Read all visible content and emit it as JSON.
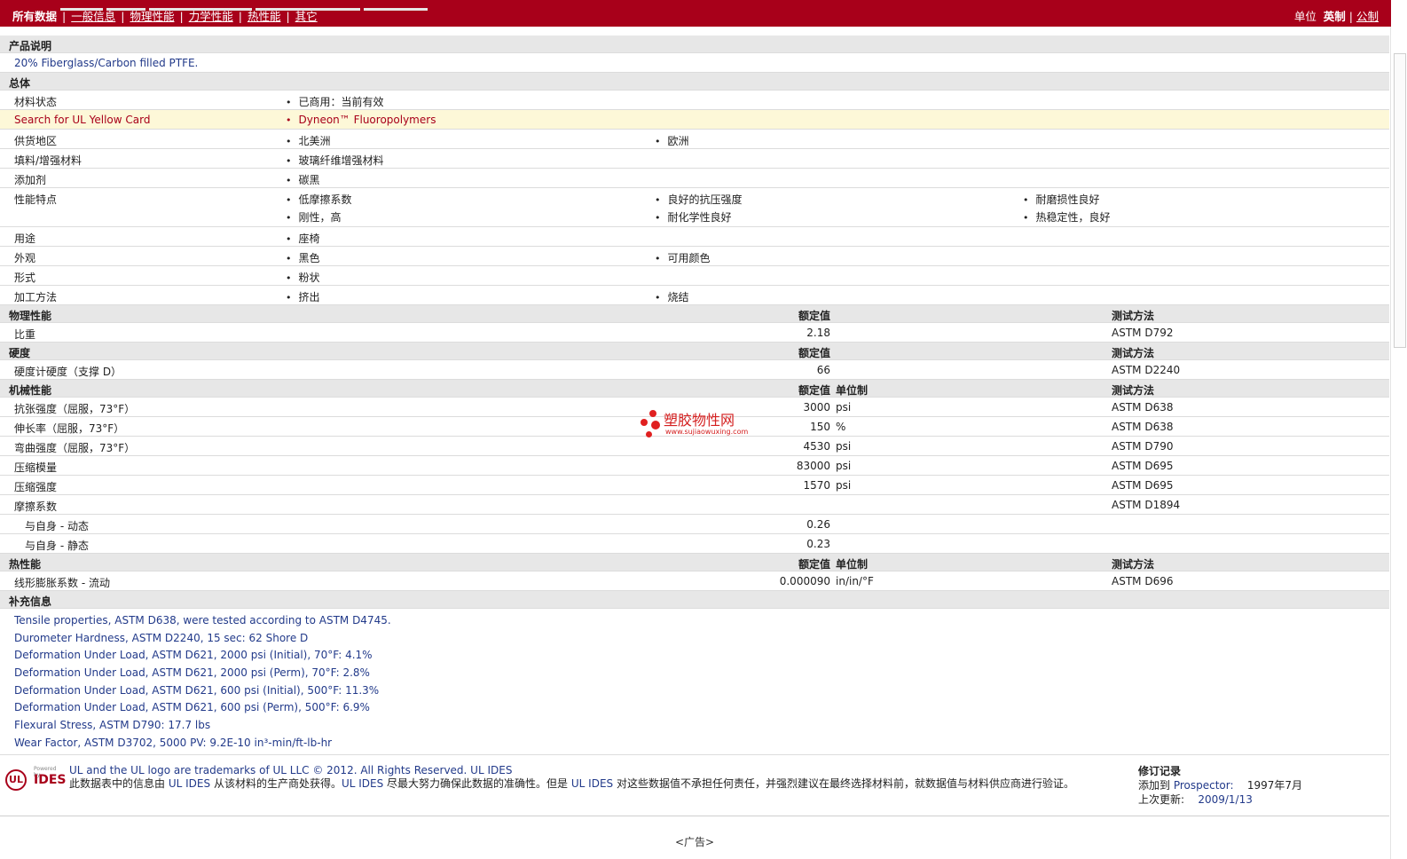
{
  "nav": {
    "items": [
      "所有数据",
      "一般信息",
      "物理性能",
      "力学性能",
      "热性能",
      "其它"
    ],
    "units_label": "单位",
    "unit_active": "英制",
    "unit_other": "公制"
  },
  "product": {
    "header": "产品说明",
    "description": "20% Fiberglass/Carbon filled PTFE."
  },
  "general": {
    "header": "总体",
    "status_label": "材料状态",
    "status_value": "已商用：当前有效",
    "ul_label": "Search for UL Yellow Card",
    "ul_value": "Dyneon™ Fluoropolymers",
    "region_label": "供货地区",
    "region_values": [
      "北美洲",
      "欧洲"
    ],
    "filler_label": "填料/增强材料",
    "filler_value": "玻璃纤维增强材料",
    "additive_label": "添加剂",
    "additive_value": "碳黑",
    "features_label": "性能特点",
    "features": [
      "低摩擦系数",
      "良好的抗压强度",
      "耐磨损性良好",
      "刚性，高",
      "耐化学性良好",
      "热稳定性，良好"
    ],
    "uses_label": "用途",
    "uses_value": "座椅",
    "appearance_label": "外观",
    "appearance_values": [
      "黑色",
      "可用颜色"
    ],
    "form_label": "形式",
    "form_value": "粉状",
    "processing_label": "加工方法",
    "processing_values": [
      "挤出",
      "烧结"
    ]
  },
  "columns": {
    "nominal": "额定值",
    "unit": "单位制",
    "test": "测试方法"
  },
  "physical": {
    "header": "物理性能",
    "rows": [
      {
        "label": "比重",
        "value": "2.18",
        "unit": "",
        "test": "ASTM D792"
      }
    ]
  },
  "hardness": {
    "header": "硬度",
    "rows": [
      {
        "label": "硬度计硬度（支撑 D）",
        "value": "66",
        "unit": "",
        "test": "ASTM D2240"
      }
    ]
  },
  "mechanical": {
    "header": "机械性能",
    "rows": [
      {
        "label": "抗张强度（屈服，73°F）",
        "value": "3000",
        "unit": "psi",
        "test": "ASTM D638"
      },
      {
        "label": "伸长率（屈服，73°F）",
        "value": "150",
        "unit": "%",
        "test": "ASTM D638"
      },
      {
        "label": "弯曲强度（屈服，73°F）",
        "value": "4530",
        "unit": "psi",
        "test": "ASTM D790"
      },
      {
        "label": "压缩模量",
        "value": "83000",
        "unit": "psi",
        "test": "ASTM D695"
      },
      {
        "label": "压缩强度",
        "value": "1570",
        "unit": "psi",
        "test": "ASTM D695"
      },
      {
        "label": "摩擦系数",
        "value": "",
        "unit": "",
        "test": "ASTM D1894"
      }
    ],
    "friction_sub": [
      {
        "label": "与自身 - 动态",
        "value": "0.26"
      },
      {
        "label": "与自身 - 静态",
        "value": "0.23"
      }
    ]
  },
  "thermal": {
    "header": "热性能",
    "rows": [
      {
        "label": "线形膨胀系数 - 流动",
        "value": "0.000090",
        "unit": "in/in/°F",
        "test": "ASTM D696"
      }
    ]
  },
  "supplement": {
    "header": "补充信息",
    "lines": [
      "Tensile properties, ASTM D638, were tested according to ASTM D4745.",
      "Durometer Hardness, ASTM D2240, 15 sec: 62 Shore D",
      "Deformation Under Load, ASTM D621, 2000 psi (Initial), 70°F: 4.1%",
      "Deformation Under Load, ASTM D621, 2000 psi (Perm), 70°F: 2.8%",
      "Deformation Under Load, ASTM D621, 600 psi (Initial), 500°F: 11.3%",
      "Deformation Under Load, ASTM D621, 600 psi (Perm), 500°F: 6.9%",
      "Flexural Stress, ASTM D790: 17.7 lbs",
      "Wear Factor, ASTM D3702, 5000 PV: 9.2E-10 in³-min/ft-lb-hr"
    ]
  },
  "footer": {
    "logo_powered": "Powered by",
    "logo_ul": "UL",
    "logo_ides": "IDES",
    "trademark": "UL and the UL logo are trademarks of UL LLC © 2012. All Rights Reserved. UL IDES",
    "disclaimer_1": "此数据表中的信息由",
    "disclaimer_ul1": "UL IDES",
    "disclaimer_2": "从该材料的生产商处获得。",
    "disclaimer_ul2": "UL IDES",
    "disclaimer_3": "尽最大努力确保此数据的准确性。但是",
    "disclaimer_ul3": "UL IDES",
    "disclaimer_4": "对这些数据值不承担任何责任，并强烈建议在最终选择材料前，就数据值与材料供应商进行验证。",
    "revision_title": "修订记录",
    "added_label": "添加到",
    "added_site": "Prospector:",
    "added_date": "1997年7月",
    "updated_label": "上次更新:",
    "updated_date": "2009/1/13",
    "ad": "<广告>"
  },
  "watermark": {
    "name": "塑胶物性网",
    "url": "www.sujiaowuxing.com"
  }
}
